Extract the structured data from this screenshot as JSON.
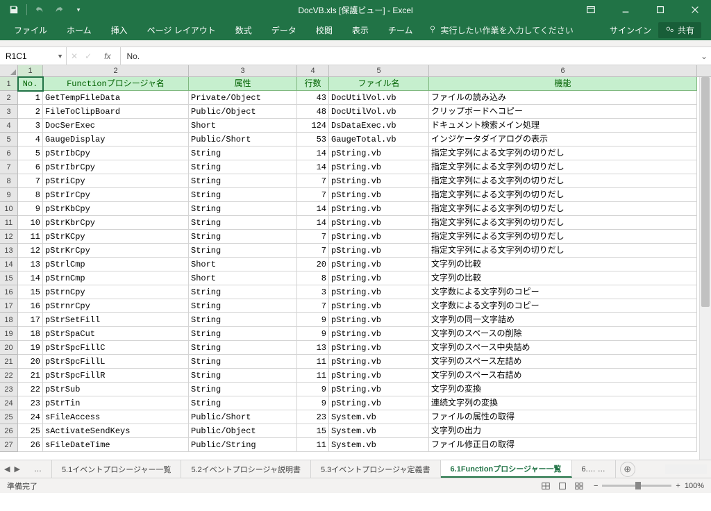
{
  "title": "DocVB.xls  [保護ビュー] - Excel",
  "qat": {
    "save": "save",
    "undo": "undo",
    "redo": "redo"
  },
  "winctrl": {
    "restore": "restore",
    "min": "min",
    "max": "max",
    "close": "close"
  },
  "ribbon": {
    "tabs": [
      "ファイル",
      "ホーム",
      "挿入",
      "ページ レイアウト",
      "数式",
      "データ",
      "校閲",
      "表示",
      "チーム"
    ],
    "tellme": "実行したい作業を入力してください",
    "signin": "サインイン",
    "share": "共有"
  },
  "formula": {
    "namebox": "R1C1",
    "fx": "No."
  },
  "colHeaders": [
    "1",
    "2",
    "3",
    "4",
    "5",
    "6"
  ],
  "headers": [
    "No.",
    "Functionプロシージャ名",
    "属性",
    "行数",
    "ファイル名",
    "機能"
  ],
  "rows": [
    {
      "n": "1",
      "a": "1",
      "b": "GetTempFileData",
      "c": "Private/Object",
      "d": "43",
      "e": "DocUtilVol.vb",
      "f": "ファイルの読み込み"
    },
    {
      "n": "2",
      "a": "2",
      "b": "FileToClipBoard",
      "c": "Public/Object",
      "d": "48",
      "e": "DocUtilVol.vb",
      "f": "クリップボードへコピー"
    },
    {
      "n": "3",
      "a": "3",
      "b": "DocSerExec",
      "c": "Short",
      "d": "124",
      "e": "DsDataExec.vb",
      "f": "ドキュメント検索メイン処理"
    },
    {
      "n": "4",
      "a": "4",
      "b": "GaugeDisplay",
      "c": "Public/Short",
      "d": "53",
      "e": "GaugeTotal.vb",
      "f": "インジケータダイアログの表示"
    },
    {
      "n": "5",
      "a": "5",
      "b": "pStrIbCpy",
      "c": "String",
      "d": "14",
      "e": "pString.vb",
      "f": "指定文字列による文字列の切りだし"
    },
    {
      "n": "6",
      "a": "6",
      "b": "pStrIbrCpy",
      "c": "String",
      "d": "14",
      "e": "pString.vb",
      "f": "指定文字列による文字列の切りだし"
    },
    {
      "n": "7",
      "a": "7",
      "b": "pStriCpy",
      "c": "String",
      "d": "7",
      "e": "pString.vb",
      "f": "指定文字列による文字列の切りだし"
    },
    {
      "n": "8",
      "a": "8",
      "b": "pStrIrCpy",
      "c": "String",
      "d": "7",
      "e": "pString.vb",
      "f": "指定文字列による文字列の切りだし"
    },
    {
      "n": "9",
      "a": "9",
      "b": "pStrKbCpy",
      "c": "String",
      "d": "14",
      "e": "pString.vb",
      "f": "指定文字列による文字列の切りだし"
    },
    {
      "n": "10",
      "a": "10",
      "b": "pStrKbrCpy",
      "c": "String",
      "d": "14",
      "e": "pString.vb",
      "f": "指定文字列による文字列の切りだし"
    },
    {
      "n": "11",
      "a": "11",
      "b": "pStrKCpy",
      "c": "String",
      "d": "7",
      "e": "pString.vb",
      "f": "指定文字列による文字列の切りだし"
    },
    {
      "n": "12",
      "a": "12",
      "b": "pStrKrCpy",
      "c": "String",
      "d": "7",
      "e": "pString.vb",
      "f": "指定文字列による文字列の切りだし"
    },
    {
      "n": "13",
      "a": "13",
      "b": "pStrlCmp",
      "c": "Short",
      "d": "20",
      "e": "pString.vb",
      "f": "文字列の比較"
    },
    {
      "n": "14",
      "a": "14",
      "b": "pStrnCmp",
      "c": "Short",
      "d": "8",
      "e": "pString.vb",
      "f": "文字列の比較"
    },
    {
      "n": "15",
      "a": "15",
      "b": "pStrnCpy",
      "c": "String",
      "d": "3",
      "e": "pString.vb",
      "f": "文字数による文字列のコピー"
    },
    {
      "n": "16",
      "a": "16",
      "b": "pStrnrCpy",
      "c": "String",
      "d": "7",
      "e": "pString.vb",
      "f": "文字数による文字列のコピー"
    },
    {
      "n": "17",
      "a": "17",
      "b": "pStrSetFill",
      "c": "String",
      "d": "9",
      "e": "pString.vb",
      "f": "文字列の同一文字詰め"
    },
    {
      "n": "18",
      "a": "18",
      "b": "pStrSpaCut",
      "c": "String",
      "d": "9",
      "e": "pString.vb",
      "f": "文字列のスペースの削除"
    },
    {
      "n": "19",
      "a": "19",
      "b": "pStrSpcFillC",
      "c": "String",
      "d": "13",
      "e": "pString.vb",
      "f": "文字列のスペース中央詰め"
    },
    {
      "n": "20",
      "a": "20",
      "b": "pStrSpcFillL",
      "c": "String",
      "d": "11",
      "e": "pString.vb",
      "f": "文字列のスペース左詰め"
    },
    {
      "n": "21",
      "a": "21",
      "b": "pStrSpcFillR",
      "c": "String",
      "d": "11",
      "e": "pString.vb",
      "f": "文字列のスペース右詰め"
    },
    {
      "n": "22",
      "a": "22",
      "b": "pStrSub",
      "c": "String",
      "d": "9",
      "e": "pString.vb",
      "f": "文字列の変換"
    },
    {
      "n": "23",
      "a": "23",
      "b": "pStrTin",
      "c": "String",
      "d": "9",
      "e": "pString.vb",
      "f": "連続文字列の変換"
    },
    {
      "n": "24",
      "a": "24",
      "b": "sFileAccess",
      "c": "Public/Short",
      "d": "23",
      "e": "System.vb",
      "f": "ファイルの属性の取得"
    },
    {
      "n": "25",
      "a": "25",
      "b": "sActivateSendKeys",
      "c": "Public/Object",
      "d": "15",
      "e": "System.vb",
      "f": "文字列の出力"
    },
    {
      "n": "26",
      "a": "26",
      "b": "sFileDateTime",
      "c": "Public/String",
      "d": "11",
      "e": "System.vb",
      "f": "ファイル修正日の取得"
    }
  ],
  "sheetTabs": [
    "…",
    "5.1イベントプロシージャー一覧",
    "5.2イベントプロシージャ説明書",
    "5.3イベントプロシージャ定義書",
    "6.1Functionプロシージャー一覧",
    "6.… …"
  ],
  "activeTab": 4,
  "status": {
    "ready": "準備完了",
    "zoom": "100%"
  }
}
